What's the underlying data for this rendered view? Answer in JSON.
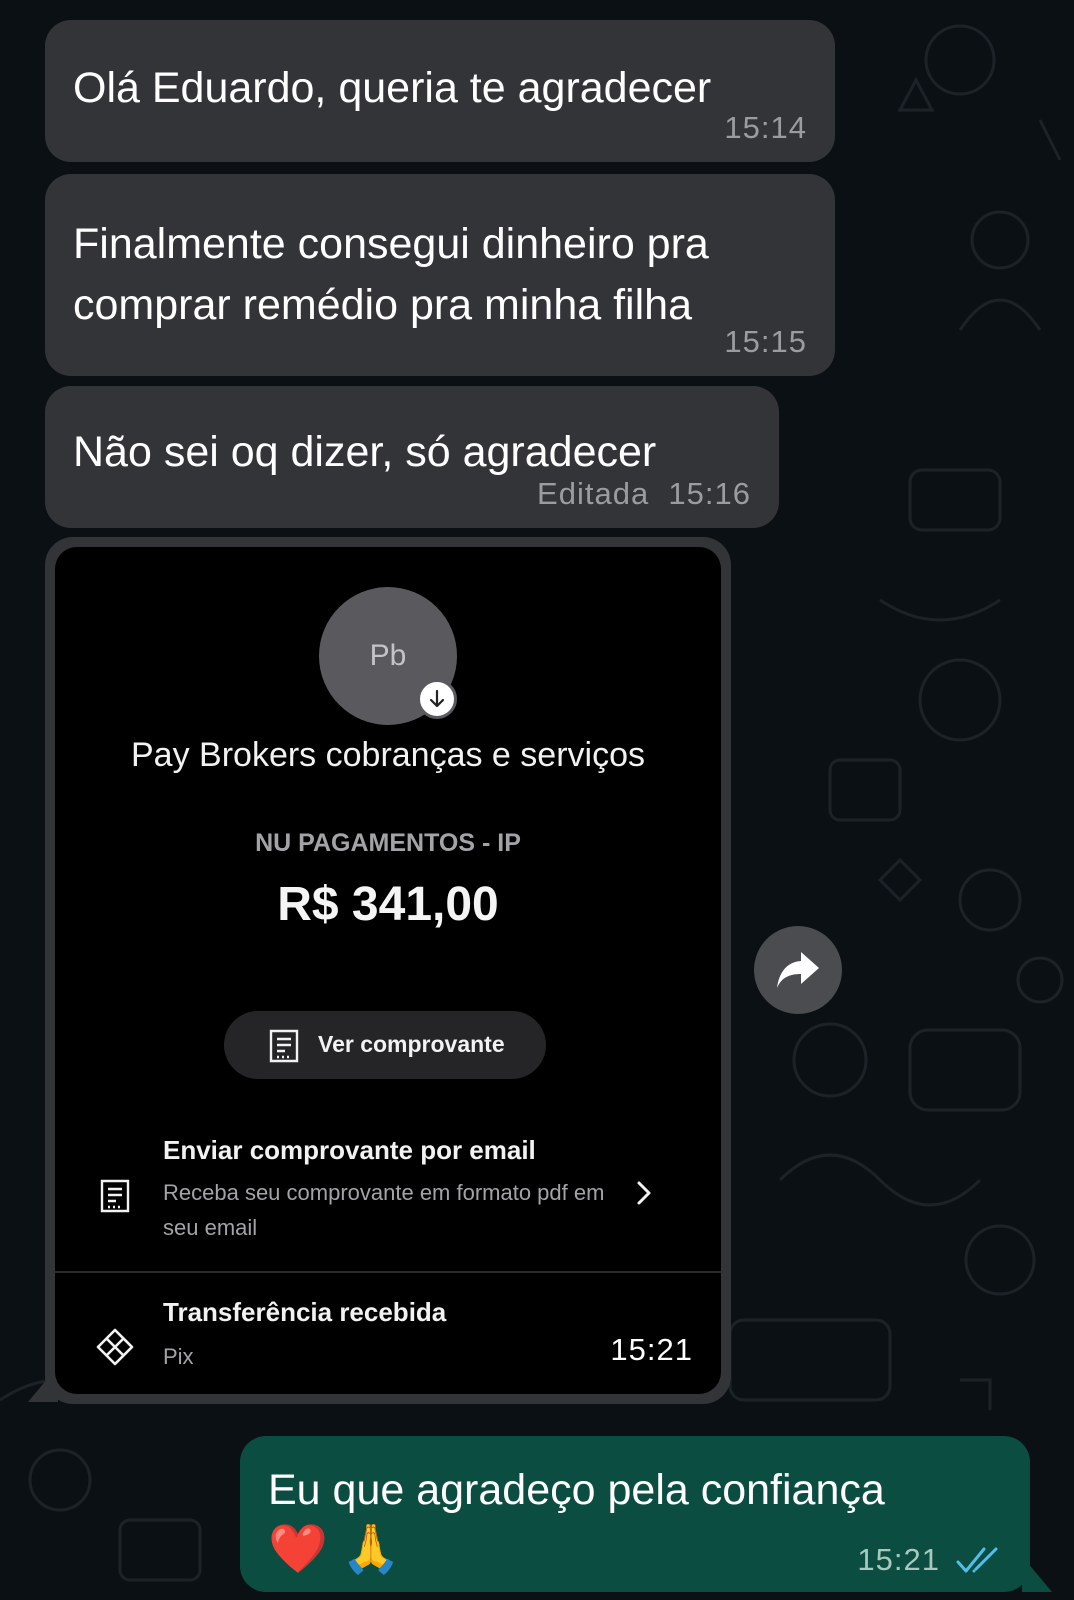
{
  "colors": {
    "background": "#0b1014",
    "incoming_bubble": "#333438",
    "outgoing_bubble": "#0b4d40",
    "read_ticks": "#53bdeb"
  },
  "messages": [
    {
      "direction": "incoming",
      "text": "Olá Eduardo, queria te agradecer",
      "time": "15:14"
    },
    {
      "direction": "incoming",
      "lines": [
        "Finalmente consegui dinheiro pra",
        "comprar remédio pra minha filha"
      ],
      "time": "15:15"
    },
    {
      "direction": "incoming",
      "text": "Não sei oq dizer, só agradecer",
      "time": "Editada  15:16"
    }
  ],
  "receipt": {
    "avatar_initials": "Pb",
    "avatar_badge_icon": "arrow-down-icon",
    "payee": "Pay Brokers cobranças e serviços",
    "bank": "NU PAGAMENTOS - IP",
    "amount": "R$ 341,00",
    "view_button": "Ver comprovante",
    "email_row": {
      "title": "Enviar comprovante por email",
      "subtitle": "Receba seu comprovante em formato pdf em seu email"
    },
    "transfer_row": {
      "title": "Transferência recebida",
      "subtitle": "Pix"
    },
    "time": "15:21"
  },
  "share_icon": "share-arrow-icon",
  "outgoing": {
    "text": "Eu que agradeço pela confiança",
    "emoji": "❤️ 🙏",
    "time": "15:21",
    "status_icon": "double-check-read-icon"
  }
}
